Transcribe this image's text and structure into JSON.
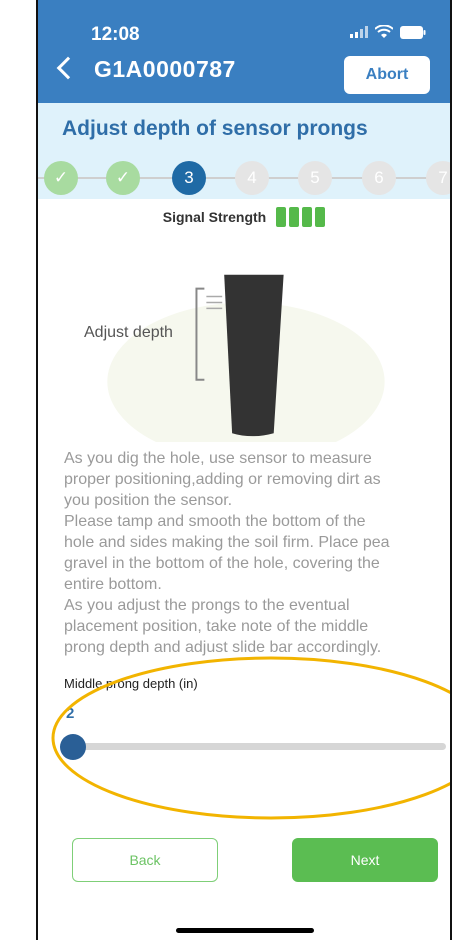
{
  "status_bar": {
    "time": "12:08"
  },
  "nav": {
    "title": "G1A0000787",
    "abort_label": "Abort"
  },
  "page": {
    "step_title": "Adjust depth of sensor prongs"
  },
  "steps": [
    {
      "label": "✓",
      "state": "done"
    },
    {
      "label": "✓",
      "state": "done"
    },
    {
      "label": "3",
      "state": "current"
    },
    {
      "label": "4",
      "state": "todo"
    },
    {
      "label": "5",
      "state": "todo"
    },
    {
      "label": "6",
      "state": "todo"
    },
    {
      "label": "7",
      "state": "todo"
    }
  ],
  "signal": {
    "label": "Signal Strength",
    "bars": 4,
    "color": "#55b94a"
  },
  "illustration": {
    "adjust_label": "Adjust depth"
  },
  "instructions": "As you dig the hole, use sensor to measure\nproper positioning,adding or removing dirt as\nyou position the sensor.\nPlease tamp and smooth the bottom of the\nhole and sides making the soil firm. Place pea\ngravel in the bottom of the hole, covering the\nentire bottom.\nAs you adjust the prongs to the eventual\nplacement position, take note of the middle\nprong depth and adjust slide bar accordingly.",
  "slider": {
    "label": "Middle prong depth (in)",
    "value": "2"
  },
  "buttons": {
    "back": "Back",
    "next": "Next"
  },
  "colors": {
    "primary": "#3a7fc1",
    "accent_green": "#5bbd52",
    "highlight": "#f2b400"
  }
}
